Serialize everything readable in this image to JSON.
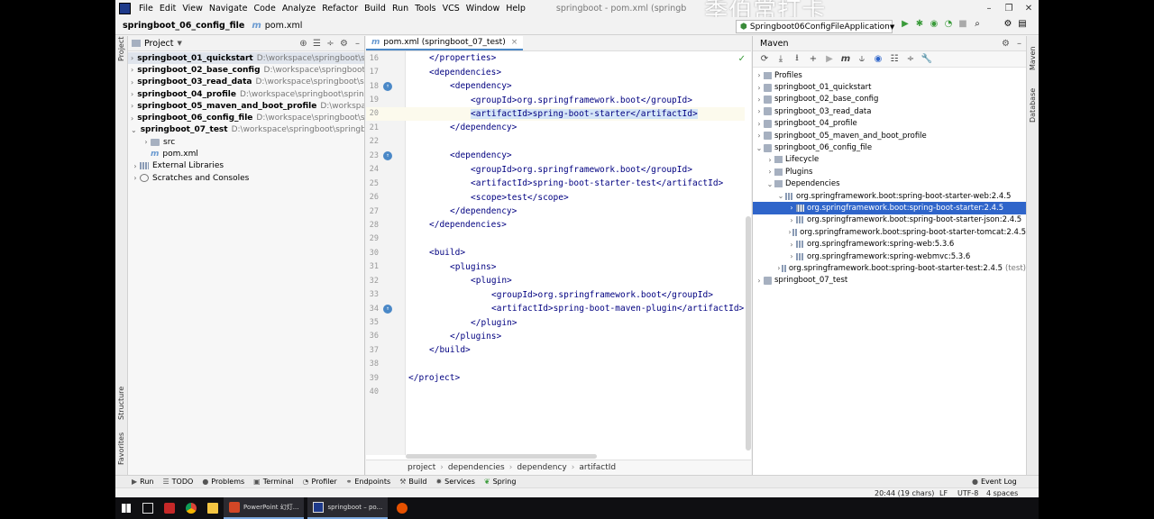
{
  "menubar": {
    "items": [
      "File",
      "Edit",
      "View",
      "Navigate",
      "Code",
      "Analyze",
      "Refactor",
      "Build",
      "Run",
      "Tools",
      "VCS",
      "Window",
      "Help"
    ],
    "window_title": "springboot - pom.xml (springb",
    "watermark": "季伯常打卡"
  },
  "navbar": {
    "project": "springboot_06_config_file",
    "file": "pom.xml",
    "run_config": "Springboot06ConfigFileApplication"
  },
  "project_panel": {
    "title": "Project",
    "items": [
      {
        "name": "springboot_01_quickstart",
        "path": "D:\\workspace\\springboot\\spr",
        "level": 0,
        "arrow": "›",
        "bold": true,
        "icon": "module",
        "selected": true
      },
      {
        "name": "springboot_02_base_config",
        "path": "D:\\workspace\\springboot\\sp",
        "level": 0,
        "arrow": "›",
        "bold": true,
        "icon": "module"
      },
      {
        "name": "springboot_03_read_data",
        "path": "D:\\workspace\\springboot\\spr",
        "level": 0,
        "arrow": "›",
        "bold": true,
        "icon": "module"
      },
      {
        "name": "springboot_04_profile",
        "path": "D:\\workspace\\springboot\\springb",
        "level": 0,
        "arrow": "›",
        "bold": true,
        "icon": "module"
      },
      {
        "name": "springboot_05_maven_and_boot_profile",
        "path": "D:\\workspace\\",
        "level": 0,
        "arrow": "›",
        "bold": true,
        "icon": "module"
      },
      {
        "name": "springboot_06_config_file",
        "path": "D:\\workspace\\springboot\\sp",
        "level": 0,
        "arrow": "›",
        "bold": true,
        "icon": "module"
      },
      {
        "name": "springboot_07_test",
        "path": "D:\\workspace\\springboot\\springbo",
        "level": 0,
        "arrow": "⌄",
        "bold": true,
        "icon": "module"
      },
      {
        "name": "src",
        "path": "",
        "level": 1,
        "arrow": "›",
        "bold": false,
        "icon": "folder"
      },
      {
        "name": "pom.xml",
        "path": "",
        "level": 1,
        "arrow": "",
        "bold": false,
        "icon": "maven"
      },
      {
        "name": "External Libraries",
        "path": "",
        "level": 0,
        "arrow": "›",
        "bold": false,
        "icon": "library"
      },
      {
        "name": "Scratches and Consoles",
        "path": "",
        "level": 0,
        "arrow": "›",
        "bold": false,
        "icon": "scratch"
      }
    ]
  },
  "editor": {
    "tab": "pom.xml (springboot_07_test)",
    "lines": [
      {
        "n": "16",
        "indent": 1,
        "text": "</properties>"
      },
      {
        "n": "17",
        "indent": 1,
        "text": "<dependencies>"
      },
      {
        "n": "18",
        "indent": 2,
        "text": "<dependency>",
        "marker": true
      },
      {
        "n": "19",
        "indent": 3,
        "text": "<groupId>org.springframework.boot</groupId>"
      },
      {
        "n": "20",
        "indent": 3,
        "text": "<artifactId>spring-boot-starter</artifactId>",
        "current": true
      },
      {
        "n": "21",
        "indent": 2,
        "text": "</dependency>"
      },
      {
        "n": "22",
        "indent": 0,
        "text": ""
      },
      {
        "n": "23",
        "indent": 2,
        "text": "<dependency>",
        "marker": true
      },
      {
        "n": "24",
        "indent": 3,
        "text": "<groupId>org.springframework.boot</groupId>"
      },
      {
        "n": "25",
        "indent": 3,
        "text": "<artifactId>spring-boot-starter-test</artifactId>"
      },
      {
        "n": "26",
        "indent": 3,
        "text": "<scope>test</scope>"
      },
      {
        "n": "27",
        "indent": 2,
        "text": "</dependency>"
      },
      {
        "n": "28",
        "indent": 1,
        "text": "</dependencies>"
      },
      {
        "n": "29",
        "indent": 0,
        "text": ""
      },
      {
        "n": "30",
        "indent": 1,
        "text": "<build>"
      },
      {
        "n": "31",
        "indent": 2,
        "text": "<plugins>"
      },
      {
        "n": "32",
        "indent": 3,
        "text": "<plugin>"
      },
      {
        "n": "33",
        "indent": 4,
        "text": "<groupId>org.springframework.boot</groupId>"
      },
      {
        "n": "34",
        "indent": 4,
        "text": "<artifactId>spring-boot-maven-plugin</artifactId>",
        "marker": true
      },
      {
        "n": "35",
        "indent": 3,
        "text": "</plugin>"
      },
      {
        "n": "36",
        "indent": 2,
        "text": "</plugins>"
      },
      {
        "n": "37",
        "indent": 1,
        "text": "</build>"
      },
      {
        "n": "38",
        "indent": 0,
        "text": ""
      },
      {
        "n": "39",
        "indent": 0,
        "text": "</project>"
      },
      {
        "n": "40",
        "indent": 0,
        "text": ""
      }
    ],
    "breadcrumb": [
      "project",
      "dependencies",
      "dependency",
      "artifactId"
    ]
  },
  "maven_panel": {
    "title": "Maven",
    "items": [
      {
        "name": "Profiles",
        "level": 0,
        "arrow": "›",
        "icon": "folder"
      },
      {
        "name": "springboot_01_quickstart",
        "level": 0,
        "arrow": "›",
        "icon": "module"
      },
      {
        "name": "springboot_02_base_config",
        "level": 0,
        "arrow": "›",
        "icon": "module"
      },
      {
        "name": "springboot_03_read_data",
        "level": 0,
        "arrow": "›",
        "icon": "module"
      },
      {
        "name": "springboot_04_profile",
        "level": 0,
        "arrow": "›",
        "icon": "module"
      },
      {
        "name": "springboot_05_maven_and_boot_profile",
        "level": 0,
        "arrow": "›",
        "icon": "module"
      },
      {
        "name": "springboot_06_config_file",
        "level": 0,
        "arrow": "⌄",
        "icon": "module"
      },
      {
        "name": "Lifecycle",
        "level": 1,
        "arrow": "›",
        "icon": "folder"
      },
      {
        "name": "Plugins",
        "level": 1,
        "arrow": "›",
        "icon": "folder"
      },
      {
        "name": "Dependencies",
        "level": 1,
        "arrow": "⌄",
        "icon": "folder"
      },
      {
        "name": "org.springframework.boot:spring-boot-starter-web:2.4.5",
        "level": 2,
        "arrow": "⌄",
        "icon": "dep"
      },
      {
        "name": "org.springframework.boot:spring-boot-starter:2.4.5",
        "level": 3,
        "arrow": "›",
        "icon": "dep",
        "selected": true
      },
      {
        "name": "org.springframework.boot:spring-boot-starter-json:2.4.5",
        "level": 3,
        "arrow": "›",
        "icon": "dep"
      },
      {
        "name": "org.springframework.boot:spring-boot-starter-tomcat:2.4.5",
        "level": 3,
        "arrow": "›",
        "icon": "dep"
      },
      {
        "name": "org.springframework:spring-web:5.3.6",
        "level": 3,
        "arrow": "›",
        "icon": "dep"
      },
      {
        "name": "org.springframework:spring-webmvc:5.3.6",
        "level": 3,
        "arrow": "›",
        "icon": "dep"
      },
      {
        "name": "org.springframework.boot:spring-boot-starter-test:2.4.5",
        "level": 2,
        "arrow": "›",
        "icon": "dep",
        "tag": "(test)"
      },
      {
        "name": "springboot_07_test",
        "level": 0,
        "arrow": "›",
        "icon": "module"
      }
    ]
  },
  "stripes": {
    "left": [
      "Project",
      "Structure",
      "Favorites"
    ],
    "right": [
      "Maven",
      "Database"
    ]
  },
  "toolwindows": [
    "Run",
    "TODO",
    "Problems",
    "Terminal",
    "Profiler",
    "Endpoints",
    "Build",
    "Services",
    "Spring"
  ],
  "statusbar": {
    "position": "20:44 (19 chars)",
    "line_sep": "LF",
    "encoding": "UTF-8",
    "indent": "4 spaces",
    "event_log": "Event Log"
  },
  "taskbar": {
    "apps": [
      "PowerPoint 幻灯...",
      "springboot – po..."
    ]
  },
  "colors": {
    "accent": "#2f65ca",
    "xml_tag": "#000080",
    "highlight": "#d4e5f7"
  }
}
